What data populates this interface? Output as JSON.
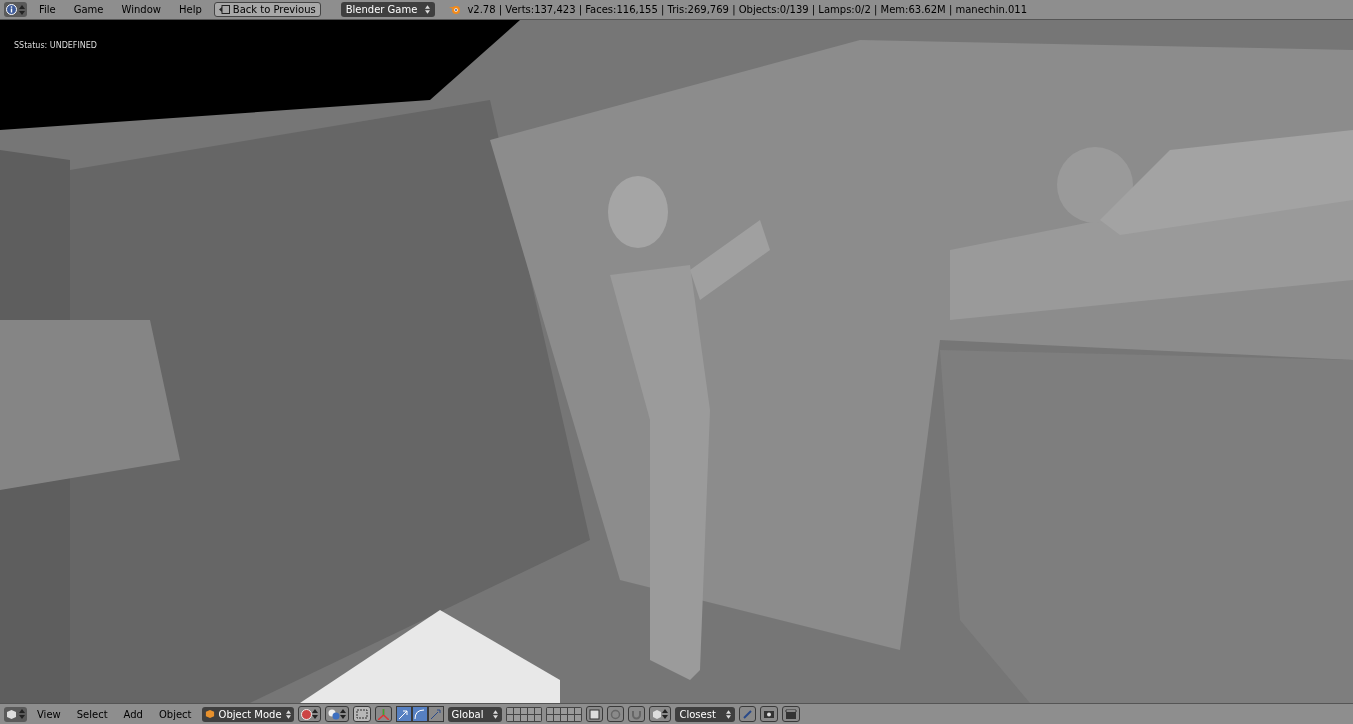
{
  "top_bar": {
    "menus": [
      "File",
      "Game",
      "Window",
      "Help"
    ],
    "back_button": "Back to Previous",
    "engine": "Blender Game",
    "stats": "v2.78 | Verts:137,423 | Faces:116,155 | Tris:269,769 | Objects:0/139 | Lamps:0/2 | Mem:63.62M | manechin.011"
  },
  "viewport": {
    "status": "SStatus: UNDEFINED"
  },
  "bottom_bar": {
    "menus": [
      "View",
      "Select",
      "Add",
      "Object"
    ],
    "mode": "Object Mode",
    "manipulators": [
      {
        "kind": "translate",
        "selected": true
      },
      {
        "kind": "rotate",
        "selected": true
      },
      {
        "kind": "scale",
        "selected": false
      }
    ],
    "orientation": "Global",
    "snap": "Closest"
  }
}
